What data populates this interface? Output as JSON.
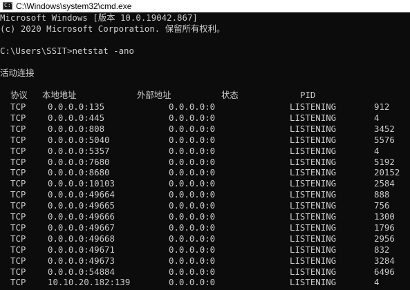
{
  "window": {
    "title": "C:\\Windows\\system32\\cmd.exe",
    "icon": "cmd-icon"
  },
  "console": {
    "banner_line1": "Microsoft Windows [版本 10.0.19042.867]",
    "banner_line2": "(c) 2020 Microsoft Corporation. 保留所有权利。",
    "prompt": "C:\\Users\\SSIT>",
    "command": "netstat -ano",
    "section_title": "活动连接",
    "headers": {
      "proto": "协议",
      "local": "本地地址",
      "foreign": "外部地址",
      "state": "状态",
      "pid": "PID"
    },
    "rows": [
      {
        "proto": "TCP",
        "local": "0.0.0.0:135",
        "foreign": "0.0.0.0:0",
        "state": "LISTENING",
        "pid": "912"
      },
      {
        "proto": "TCP",
        "local": "0.0.0.0:445",
        "foreign": "0.0.0.0:0",
        "state": "LISTENING",
        "pid": "4"
      },
      {
        "proto": "TCP",
        "local": "0.0.0.0:808",
        "foreign": "0.0.0.0:0",
        "state": "LISTENING",
        "pid": "3452"
      },
      {
        "proto": "TCP",
        "local": "0.0.0.0:5040",
        "foreign": "0.0.0.0:0",
        "state": "LISTENING",
        "pid": "5576"
      },
      {
        "proto": "TCP",
        "local": "0.0.0.0:5357",
        "foreign": "0.0.0.0:0",
        "state": "LISTENING",
        "pid": "4"
      },
      {
        "proto": "TCP",
        "local": "0.0.0.0:7680",
        "foreign": "0.0.0.0:0",
        "state": "LISTENING",
        "pid": "5192"
      },
      {
        "proto": "TCP",
        "local": "0.0.0.0:8680",
        "foreign": "0.0.0.0:0",
        "state": "LISTENING",
        "pid": "20152"
      },
      {
        "proto": "TCP",
        "local": "0.0.0.0:10103",
        "foreign": "0.0.0.0:0",
        "state": "LISTENING",
        "pid": "2584"
      },
      {
        "proto": "TCP",
        "local": "0.0.0.0:49664",
        "foreign": "0.0.0.0:0",
        "state": "LISTENING",
        "pid": "888"
      },
      {
        "proto": "TCP",
        "local": "0.0.0.0:49665",
        "foreign": "0.0.0.0:0",
        "state": "LISTENING",
        "pid": "756"
      },
      {
        "proto": "TCP",
        "local": "0.0.0.0:49666",
        "foreign": "0.0.0.0:0",
        "state": "LISTENING",
        "pid": "1300"
      },
      {
        "proto": "TCP",
        "local": "0.0.0.0:49667",
        "foreign": "0.0.0.0:0",
        "state": "LISTENING",
        "pid": "1796"
      },
      {
        "proto": "TCP",
        "local": "0.0.0.0:49668",
        "foreign": "0.0.0.0:0",
        "state": "LISTENING",
        "pid": "2956"
      },
      {
        "proto": "TCP",
        "local": "0.0.0.0:49671",
        "foreign": "0.0.0.0:0",
        "state": "LISTENING",
        "pid": "832"
      },
      {
        "proto": "TCP",
        "local": "0.0.0.0:49673",
        "foreign": "0.0.0.0:0",
        "state": "LISTENING",
        "pid": "3284"
      },
      {
        "proto": "TCP",
        "local": "0.0.0.0:54884",
        "foreign": "0.0.0.0:0",
        "state": "LISTENING",
        "pid": "6496"
      },
      {
        "proto": "TCP",
        "local": "10.10.20.182:139",
        "foreign": "0.0.0.0:0",
        "state": "LISTENING",
        "pid": "4"
      }
    ]
  },
  "colors": {
    "console_background": "#0c0c0c",
    "console_text": "#cccccc",
    "titlebar_background": "#ffffff"
  }
}
